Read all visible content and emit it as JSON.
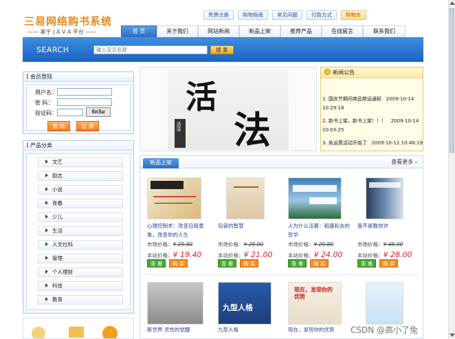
{
  "logo": {
    "title": "三易网络购书系统",
    "subtitle": "—— 基于 J A V A 平台 ——"
  },
  "top_links": [
    "免费注册",
    "购物指南",
    "常见问题",
    "付款方式",
    "购物车"
  ],
  "nav": [
    "首 页",
    "关于我们",
    "网站新闻",
    "新品上架",
    "推荐产品",
    "在线留言",
    "联系我们"
  ],
  "search": {
    "label": "SEARCH",
    "placeholder": "输入宝贝名称",
    "button": "搜 索"
  },
  "login": {
    "title": "会员登陆",
    "username_label": "用户名：",
    "password_label": "密  码：",
    "captcha_label": "验证码：",
    "captcha_text": "6nSw",
    "login_button": "登 陆",
    "register_button": "注 册"
  },
  "categories": {
    "title": "产品分类",
    "items": [
      "文艺",
      "励志",
      "小说",
      "青春",
      "少儿",
      "生活",
      "人文社科",
      "管理",
      "个人理财",
      "科技",
      "教育"
    ]
  },
  "banner": {
    "big_chars": [
      "活",
      "法"
    ],
    "small_text": "活法"
  },
  "news": {
    "title": "新闻公告",
    "items": [
      {
        "text": "1. 国庆节期间商品禁运通知",
        "date": "2009-10-14 10:29:18"
      },
      {
        "text": "2. 新书上架，新书上架！！！",
        "date": "2009-10-14 10:03:25"
      },
      {
        "text": "3. 免运费活动开始了",
        "date": "2009-10-12 10:46:19"
      }
    ]
  },
  "products": {
    "tab": "新品上架",
    "more": "查看更多 ›",
    "market_label": "市场价格：",
    "site_label": "本站价格：",
    "view_button": "查 看",
    "buy_button": "购 买",
    "items": [
      {
        "title": "心理控制术：改变自我意象，改变你的人生",
        "market": "¥ 29.80",
        "site": "¥ 19.40"
      },
      {
        "title": "包容的智慧",
        "market": "¥ 28.00",
        "site": "¥ 21.00"
      },
      {
        "title": "人为什么活着：稻盛和夫的哲学",
        "market": "¥ 29.80",
        "site": "¥ 24.00"
      },
      {
        "title": "我不是教你诈",
        "market": "¥ 48.00",
        "site": "¥ 28.00"
      }
    ],
    "row2": [
      {
        "title": "新世界 灵性的觉醒"
      },
      {
        "title": "九型人格"
      },
      {
        "title": "现在，发现你的优势"
      },
      {
        "title": ""
      }
    ],
    "row2_covers": [
      "",
      "九型人格",
      "现在，发现你的优势",
      ""
    ]
  },
  "watermark": "CSDN @高小了兔"
}
